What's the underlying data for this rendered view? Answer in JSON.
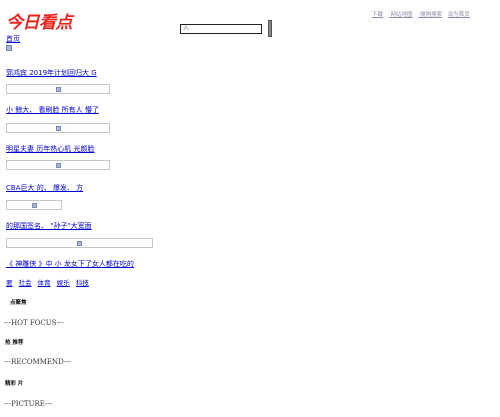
{
  "header": {
    "logo_text": "今日看点",
    "search_placeholder": "入",
    "top_links": [
      "下载",
      "·网站地图",
      "·搜狗搜索",
      "设为首页"
    ]
  },
  "home_link": "首页",
  "news": [
    {
      "title": "郭鸿宾 2019年计划回归大 G"
    },
    {
      "title": "小 鲸大、 看刷脸 所有人 懵了"
    },
    {
      "title": "明星夫妻 历年热心机 光颜脸"
    },
    {
      "title": "CBA巨大 的、 爆发、 方"
    },
    {
      "title": " 的那国签名、 \"孙子\"大宽面"
    },
    {
      "title": "《 神雕侠 》中 小 龙女下了女人都在吃的"
    }
  ],
  "categories": [
    "要",
    "社会",
    "体育",
    "娱乐",
    "科技"
  ],
  "labels": {
    "hot": "点聚焦",
    "recommend": "热 推荐",
    "picture": "精彩 片"
  },
  "sections": {
    "hot_focus": "---HOT FOCUS---",
    "recommend": "---RECOMMEND---",
    "picture": "---PICTURE---"
  },
  "colors": {
    "brand": "#e8241d",
    "link": "#0000cc",
    "placeholder_img": "#a9b9d6"
  }
}
